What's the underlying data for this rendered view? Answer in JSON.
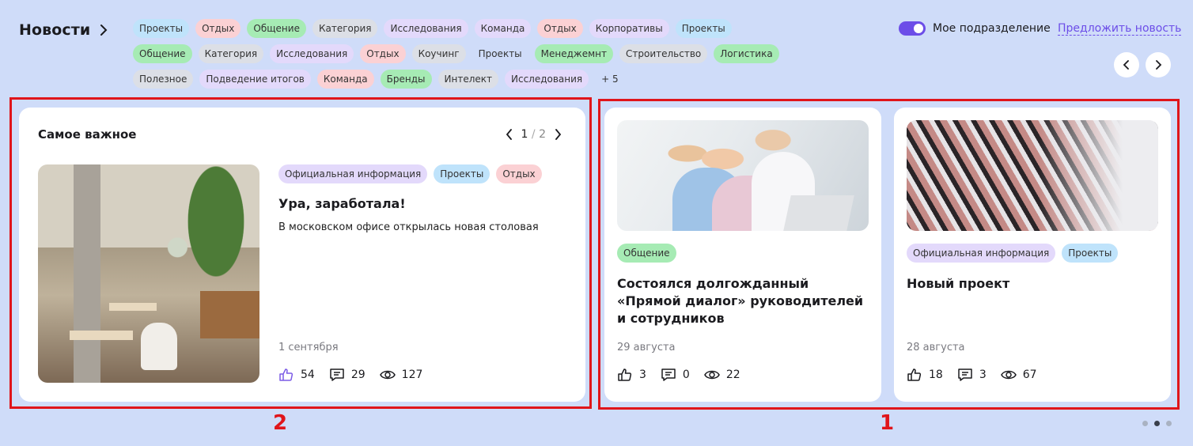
{
  "header": {
    "title": "Новости",
    "toggle_label": "Мое подразделение",
    "suggest_link": "Предложить новость"
  },
  "filter_tags": [
    {
      "label": "Проекты",
      "color": "blue"
    },
    {
      "label": "Отдых",
      "color": "pink"
    },
    {
      "label": "Общение",
      "color": "green"
    },
    {
      "label": "Категория",
      "color": "gray"
    },
    {
      "label": "Исследования",
      "color": "violet"
    },
    {
      "label": "Команда",
      "color": "violet"
    },
    {
      "label": "Отдых",
      "color": "pink"
    },
    {
      "label": "Корпоративы",
      "color": "violet"
    },
    {
      "label": "Проекты",
      "color": "blue"
    },
    {
      "label": "Общение",
      "color": "green"
    },
    {
      "label": "Категория",
      "color": "gray"
    },
    {
      "label": "Исследования",
      "color": "violet"
    },
    {
      "label": "Отдых",
      "color": "pink"
    },
    {
      "label": "Коучинг",
      "color": "gray"
    },
    {
      "label": "Проекты",
      "color": "plain"
    },
    {
      "label": "Менеджемнт",
      "color": "green"
    },
    {
      "label": "Строительство",
      "color": "gray"
    },
    {
      "label": "Логистика",
      "color": "green"
    },
    {
      "label": "Полезное",
      "color": "gray"
    },
    {
      "label": "Подведение итогов",
      "color": "violet"
    },
    {
      "label": "Команда",
      "color": "pink"
    },
    {
      "label": "Бренды",
      "color": "green"
    },
    {
      "label": "Интелект",
      "color": "gray"
    },
    {
      "label": "Исследования",
      "color": "violet"
    },
    {
      "label": "+ 5",
      "color": "plain"
    }
  ],
  "featured": {
    "heading": "Самое важное",
    "pager": {
      "current": "1",
      "separator": "/",
      "total": "2"
    },
    "tags": [
      {
        "label": "Официальная информация",
        "color": "violet"
      },
      {
        "label": "Проекты",
        "color": "blue"
      },
      {
        "label": "Отдых",
        "color": "pink"
      }
    ],
    "title": "Ура, заработала!",
    "description": "В московском офисе открылась новая столовая",
    "date": "1 сентября",
    "likes": "54",
    "comments": "29",
    "views": "127"
  },
  "news": [
    {
      "tags": [
        {
          "label": "Общение",
          "color": "green"
        }
      ],
      "title": "Состоялся долгожданный «Прямой диалог» руководителей и сотрудников",
      "date": "29 августа",
      "likes": "3",
      "comments": "0",
      "views": "22"
    },
    {
      "tags": [
        {
          "label": "Официальная информация",
          "color": "violet"
        },
        {
          "label": "Проекты",
          "color": "blue"
        }
      ],
      "title": "Новый проект",
      "date": "28 августа",
      "likes": "18",
      "comments": "3",
      "views": "67"
    }
  ],
  "annotations": {
    "left": "2",
    "right": "1"
  },
  "colors": {
    "accent": "#6c4de8",
    "annotation_red": "#e0151b",
    "background": "#cfdcf9"
  }
}
